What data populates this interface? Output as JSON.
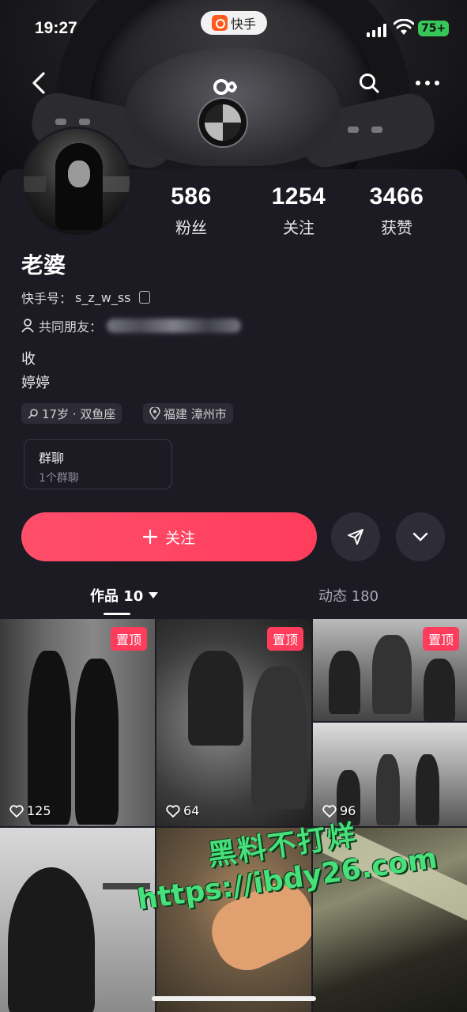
{
  "status": {
    "time": "19:27",
    "app_name": "快手",
    "battery": "75+"
  },
  "profile": {
    "stats": [
      {
        "num": "586",
        "label": "粉丝"
      },
      {
        "num": "1254",
        "label": "关注"
      },
      {
        "num": "3466",
        "label": "获赞"
      }
    ],
    "name": "老婆",
    "kuaishou_id_label": "快手号：",
    "kuaishou_id": "s_z_w_ss",
    "mutual_friends_label": "共同朋友：",
    "bio_lines": [
      "收",
      "婷婷"
    ],
    "tags": [
      "17岁 · 双鱼座",
      "福建 漳州市"
    ],
    "group_chat": {
      "title": "群聊",
      "subtitle": "1个群聊"
    },
    "follow_label": "关注"
  },
  "tabs": {
    "works": "作品 10",
    "moments": "动态 180"
  },
  "grid": {
    "pin_label": "置顶",
    "likes": [
      "125",
      "64",
      "96"
    ]
  },
  "watermark": {
    "line1": "黑料不打烊",
    "line2": "https://ibdy26.com"
  },
  "colors": {
    "accent": "#fe3c5c",
    "background": "#1c1b24"
  }
}
